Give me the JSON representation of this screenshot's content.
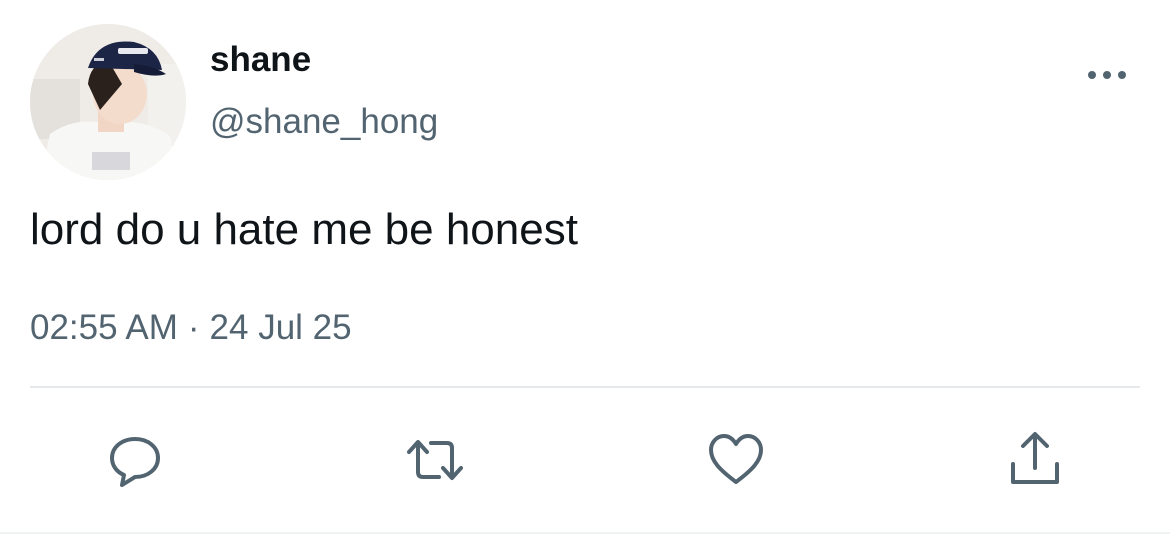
{
  "user": {
    "display_name": "shane",
    "handle": "@shane_hong"
  },
  "tweet": {
    "text": "lord do u hate me be honest",
    "time": "02:55 AM",
    "separator": "·",
    "date": "24 Jul 25"
  },
  "actions": [
    {
      "icon": "reply-icon"
    },
    {
      "icon": "retweet-icon"
    },
    {
      "icon": "like-icon"
    },
    {
      "icon": "share-icon"
    }
  ],
  "colors": {
    "text": "#0f1419",
    "secondary": "#536471",
    "divider": "#e6e9eb"
  }
}
